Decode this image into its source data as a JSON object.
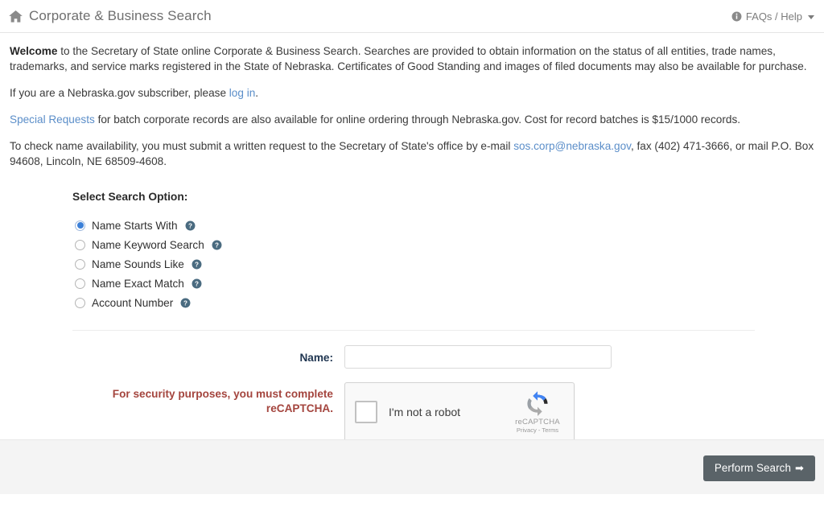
{
  "header": {
    "home_icon": "home-icon",
    "title": "Corporate & Business Search",
    "help_icon": "info-circle-icon",
    "help_label": "FAQs / Help",
    "caret_icon": "chevron-down-icon"
  },
  "intro": {
    "p1_bold": "Welcome",
    "p1_rest": " to the Secretary of State online Corporate & Business Search. Searches are provided to obtain information on the status of all entities, trade names, trademarks, and service marks registered in the State of Nebraska. Certificates of Good Standing and images of filed documents may also be available for purchase.",
    "p2_pre": "If you are a Nebraska.gov subscriber, please ",
    "p2_link": "log in",
    "p2_post": ".",
    "p3_link": "Special Requests",
    "p3_rest": " for batch corporate records are also available for online ordering through Nebraska.gov. Cost for record batches is $15/1000 records.",
    "p4_pre": "To check name availability, you must submit a written request to the Secretary of State's office by e-mail ",
    "p4_link": "sos.corp@nebraska.gov",
    "p4_post": ", fax (402) 471-3666, or mail P.O. Box 94608, Lincoln, NE 68509-4608."
  },
  "search_options": {
    "title": "Select Search Option:",
    "help_icon": "question-mark-circle-icon",
    "items": [
      {
        "label": "Name Starts With",
        "selected": true
      },
      {
        "label": "Name Keyword Search",
        "selected": false
      },
      {
        "label": "Name Sounds Like",
        "selected": false
      },
      {
        "label": "Name Exact Match",
        "selected": false
      },
      {
        "label": "Account Number",
        "selected": false
      }
    ]
  },
  "form": {
    "name_label": "Name:",
    "name_value": "",
    "name_placeholder": "",
    "security_warning_line1": "For security purposes, you must complete",
    "security_warning_line2": "reCAPTCHA."
  },
  "recaptcha": {
    "checkbox_checked": false,
    "label": "I'm not a robot",
    "logo_icon": "recaptcha-logo-icon",
    "brand": "reCAPTCHA",
    "terms": "Privacy - Terms"
  },
  "footer": {
    "submit_label": "Perform Search",
    "submit_arrow": "➡"
  },
  "colors": {
    "link": "#5b8ec9",
    "warning_text": "#a4453e",
    "button_bg": "#5a6368",
    "radio_selected": "#3b80d8",
    "help_icon": "#4a6b80",
    "label_text": "#1f3550"
  }
}
